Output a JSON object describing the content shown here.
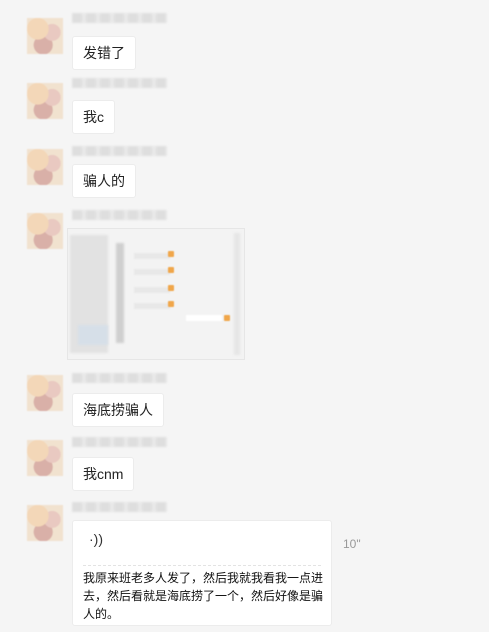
{
  "messages": [
    {
      "text": "发错了"
    },
    {
      "text": "我c"
    },
    {
      "text": "骗人的"
    },
    {
      "type": "image"
    },
    {
      "text": "海底捞骗人"
    },
    {
      "text": "我cnm"
    },
    {
      "type": "voice",
      "wave_icon": "·))",
      "duration": "10\"",
      "transcript": "我原来班老多人发了，然后我就我看我一点进去，然后看就是海底捞了一个，然后好像是骗人的。"
    }
  ],
  "colors": {
    "background": "#f5f5f5",
    "bubble": "#ffffff",
    "text": "#222222",
    "duration": "#999999"
  }
}
